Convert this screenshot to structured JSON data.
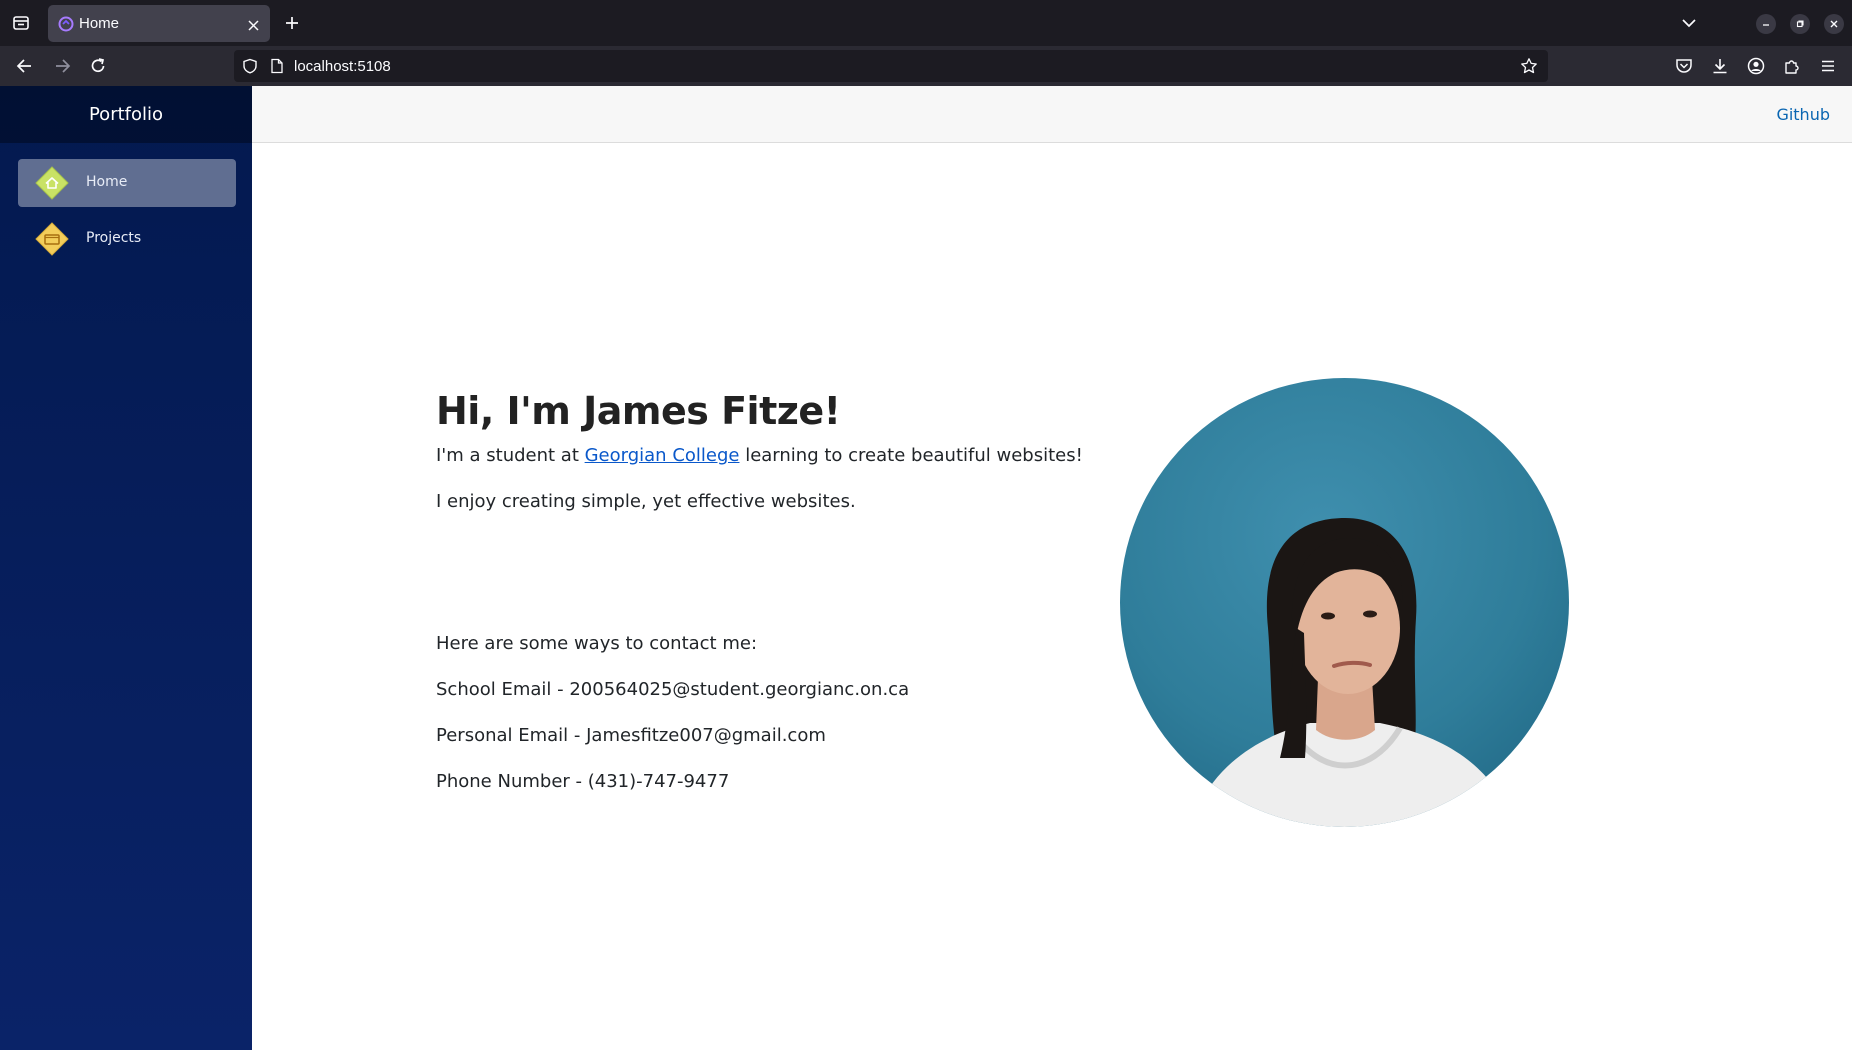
{
  "browser": {
    "tab_title": "Home",
    "url": "localhost:5108"
  },
  "sidebar": {
    "brand": "Portfolio",
    "items": [
      {
        "label": "Home",
        "icon": "home-icon",
        "active": true
      },
      {
        "label": "Projects",
        "icon": "folder-icon",
        "active": false
      }
    ]
  },
  "topbar": {
    "github_label": "Github"
  },
  "main": {
    "heading": "Hi, I'm James Fitze!",
    "intro_before": "I'm a student at ",
    "intro_link": "Georgian College",
    "intro_after": " learning to create beautiful websites!",
    "enjoy": "I enjoy creating simple, yet effective websites.",
    "contact_heading": "Here are some ways to contact me:",
    "school_email": "School Email - 200564025@student.georgianc.on.ca",
    "personal_email": "Personal Email - Jamesfitze007@gmail.com",
    "phone": "Phone Number - (431)-747-9477"
  },
  "colors": {
    "sidebar": "#03194f",
    "link": "#0a58ca",
    "github": "#0a66b2",
    "photo_background": "#2f7d9a"
  }
}
